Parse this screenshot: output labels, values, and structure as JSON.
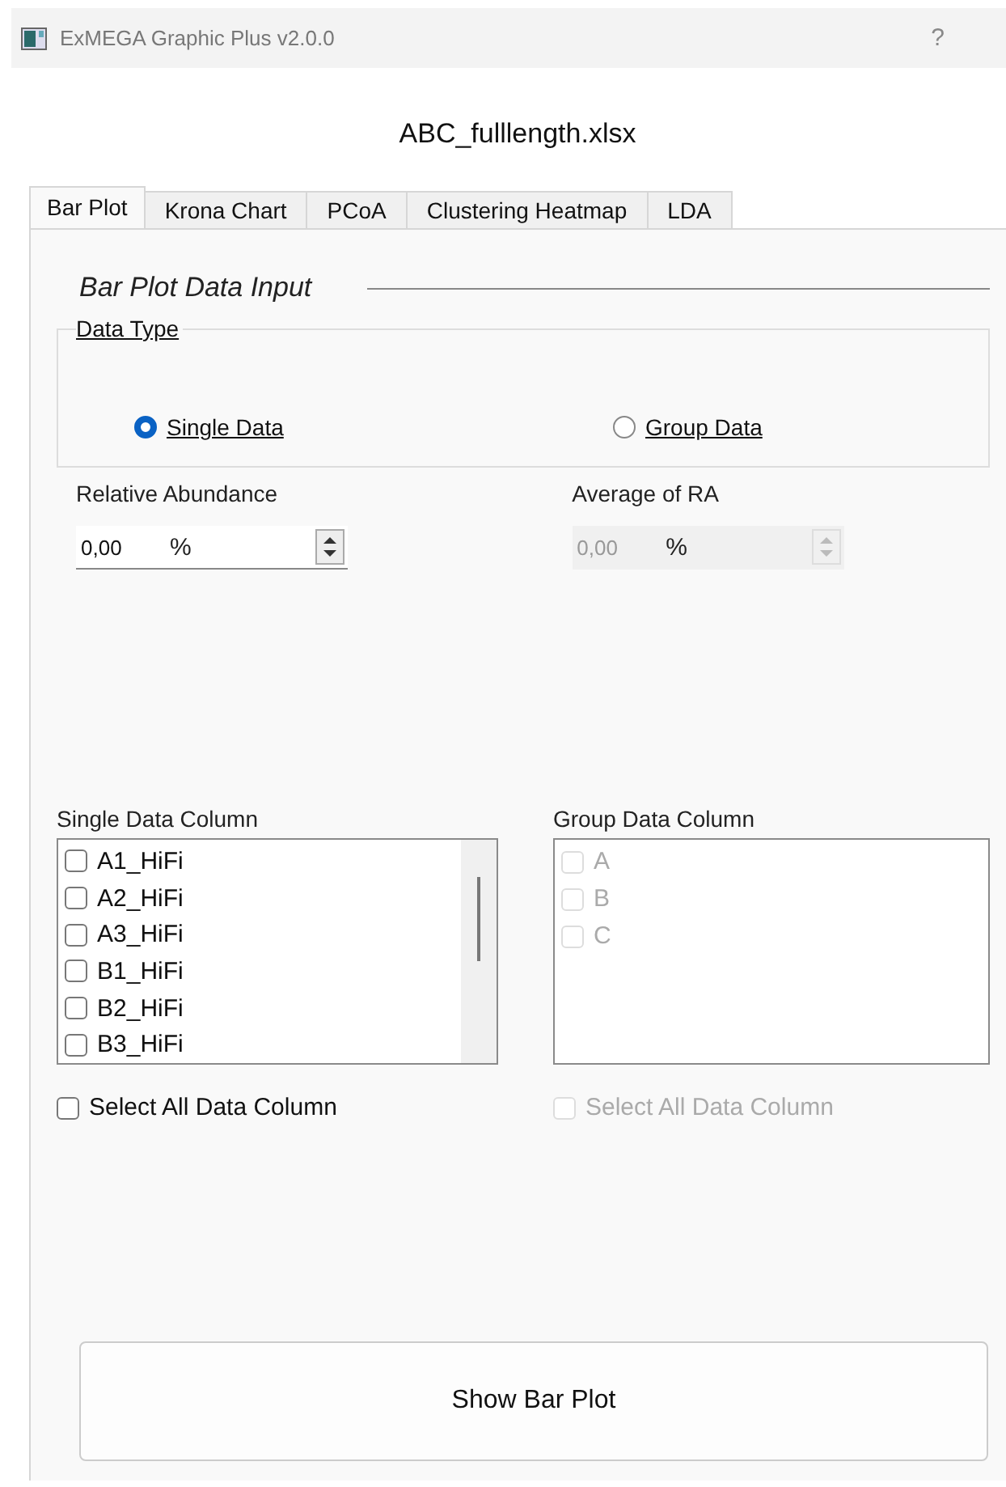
{
  "window": {
    "title": "ExMEGA Graphic Plus v2.0.0",
    "buttons": [
      "?"
    ]
  },
  "file_name": "ABC_fulllength.xlsx",
  "tabs": [
    {
      "label": "Bar Plot",
      "selected": true
    },
    {
      "label": "Krona Chart",
      "selected": false
    },
    {
      "label": "PCoA",
      "selected": false
    },
    {
      "label": "Clustering Heatmap",
      "selected": false
    },
    {
      "label": "LDA",
      "selected": false
    }
  ],
  "section_title": "Bar Plot Data Input",
  "data_type": {
    "title": "Data Type",
    "options": [
      {
        "label": " Single Data",
        "selected": true
      },
      {
        "label": " Group Data",
        "selected": false
      }
    ]
  },
  "spinboxes": [
    {
      "label": "Relative Abundance",
      "value": "0,00",
      "suffix": "%",
      "disabled": false
    },
    {
      "label": "Average of RA",
      "value": "0,00",
      "suffix": "%",
      "disabled": true
    }
  ],
  "lists": [
    {
      "label": "Single Data Column",
      "disabled": false,
      "scrollbar": true,
      "items": [
        {
          "label": "A1_HiFi",
          "checked": false
        },
        {
          "label": "A2_HiFi",
          "checked": false
        },
        {
          "label": "A3_HiFi",
          "checked": false
        },
        {
          "label": "B1_HiFi",
          "checked": false
        },
        {
          "label": "B2_HiFi",
          "checked": false
        },
        {
          "label": "B3_HiFi",
          "checked": false
        }
      ],
      "select_all": {
        "label": "Select All Data Column",
        "checked": false
      }
    },
    {
      "label": "Group Data Column",
      "disabled": true,
      "items": [
        {
          "label": "A",
          "checked": false
        },
        {
          "label": "B",
          "checked": false
        },
        {
          "label": "C",
          "checked": false
        }
      ],
      "select_all": {
        "label": "Select All Data Column",
        "checked": false
      }
    }
  ],
  "action_button": "Show Bar Plot"
}
